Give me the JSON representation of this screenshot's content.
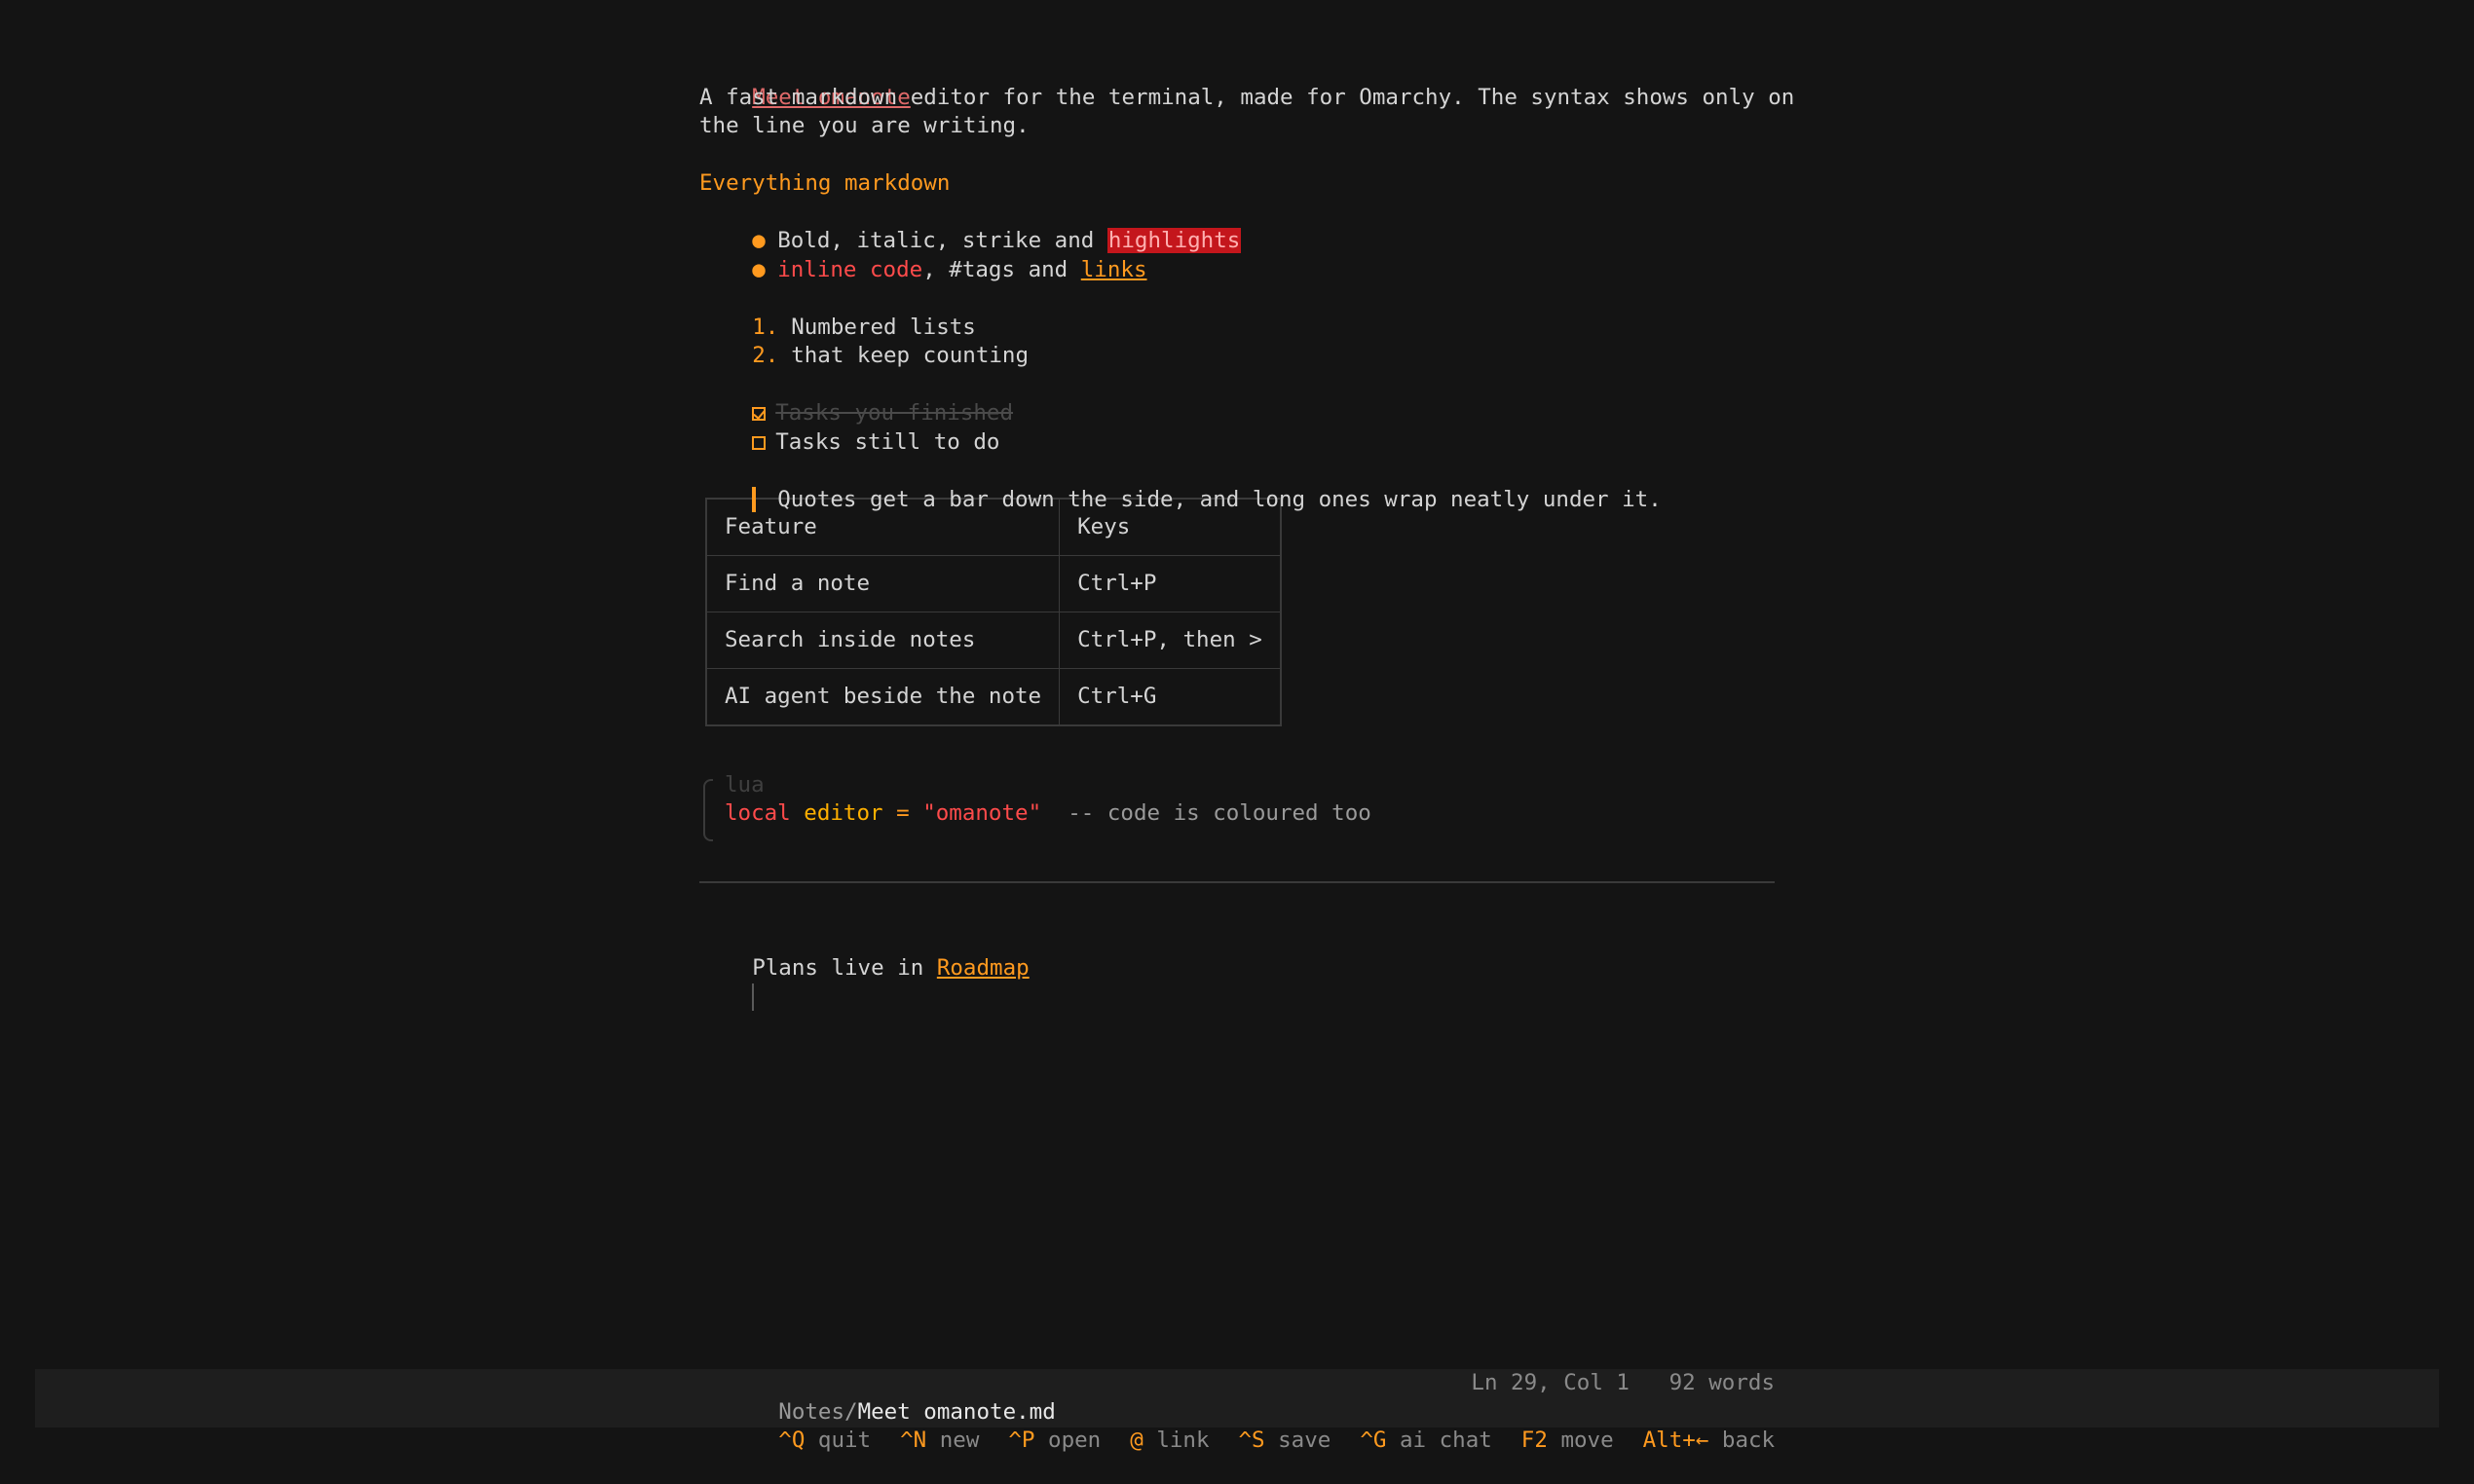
{
  "document": {
    "title": "Meet omanote",
    "intro_line1": "A fast markdown editor for the terminal, made for Omarchy. The syntax shows only on",
    "intro_line2": "the line you are writing.",
    "section_heading": "Everything markdown",
    "bullet1_text": "Bold, italic, strike and ",
    "bullet1_highlight": "highlights",
    "bullet2_code": "inline code",
    "bullet2_mid": ", #tags and ",
    "bullet2_link": "links",
    "numbered": [
      {
        "num": "1.",
        "text": "Numbered lists"
      },
      {
        "num": "2.",
        "text": "that keep counting"
      }
    ],
    "task_done": "Tasks you finished",
    "task_todo": "Tasks still to do",
    "quote": "Quotes get a bar down the side, and long ones wrap neatly under it.",
    "table": {
      "headers": [
        "Feature",
        "Keys"
      ],
      "rows": [
        [
          "Find a note",
          "Ctrl+P"
        ],
        [
          "Search inside notes",
          "Ctrl+P, then >"
        ],
        [
          "AI agent beside the note",
          "Ctrl+G"
        ]
      ]
    },
    "code": {
      "lang": "lua",
      "keyword": "local",
      "ident": "editor",
      "op": "=",
      "string": "\"omanote\"",
      "comment": "-- code is coloured too"
    },
    "footer_text": "Plans live in ",
    "footer_link": "Roadmap"
  },
  "status": {
    "path_dir": "Notes/",
    "path_file": "Meet omanote.md",
    "position": "Ln 29, Col 1",
    "word_count": "92 words",
    "shortcuts": [
      {
        "key": "^Q",
        "label": "quit"
      },
      {
        "key": "^N",
        "label": "new"
      },
      {
        "key": "^P",
        "label": "open"
      },
      {
        "key": "@",
        "label": "link"
      },
      {
        "key": "^S",
        "label": "save"
      },
      {
        "key": "^G",
        "label": "ai chat"
      },
      {
        "key": "F2",
        "label": "move"
      },
      {
        "key": "Alt+←",
        "label": "back"
      }
    ]
  },
  "colors": {
    "background": "#141414",
    "accent": "#ff9a1f",
    "red": "#ff4b4b"
  }
}
